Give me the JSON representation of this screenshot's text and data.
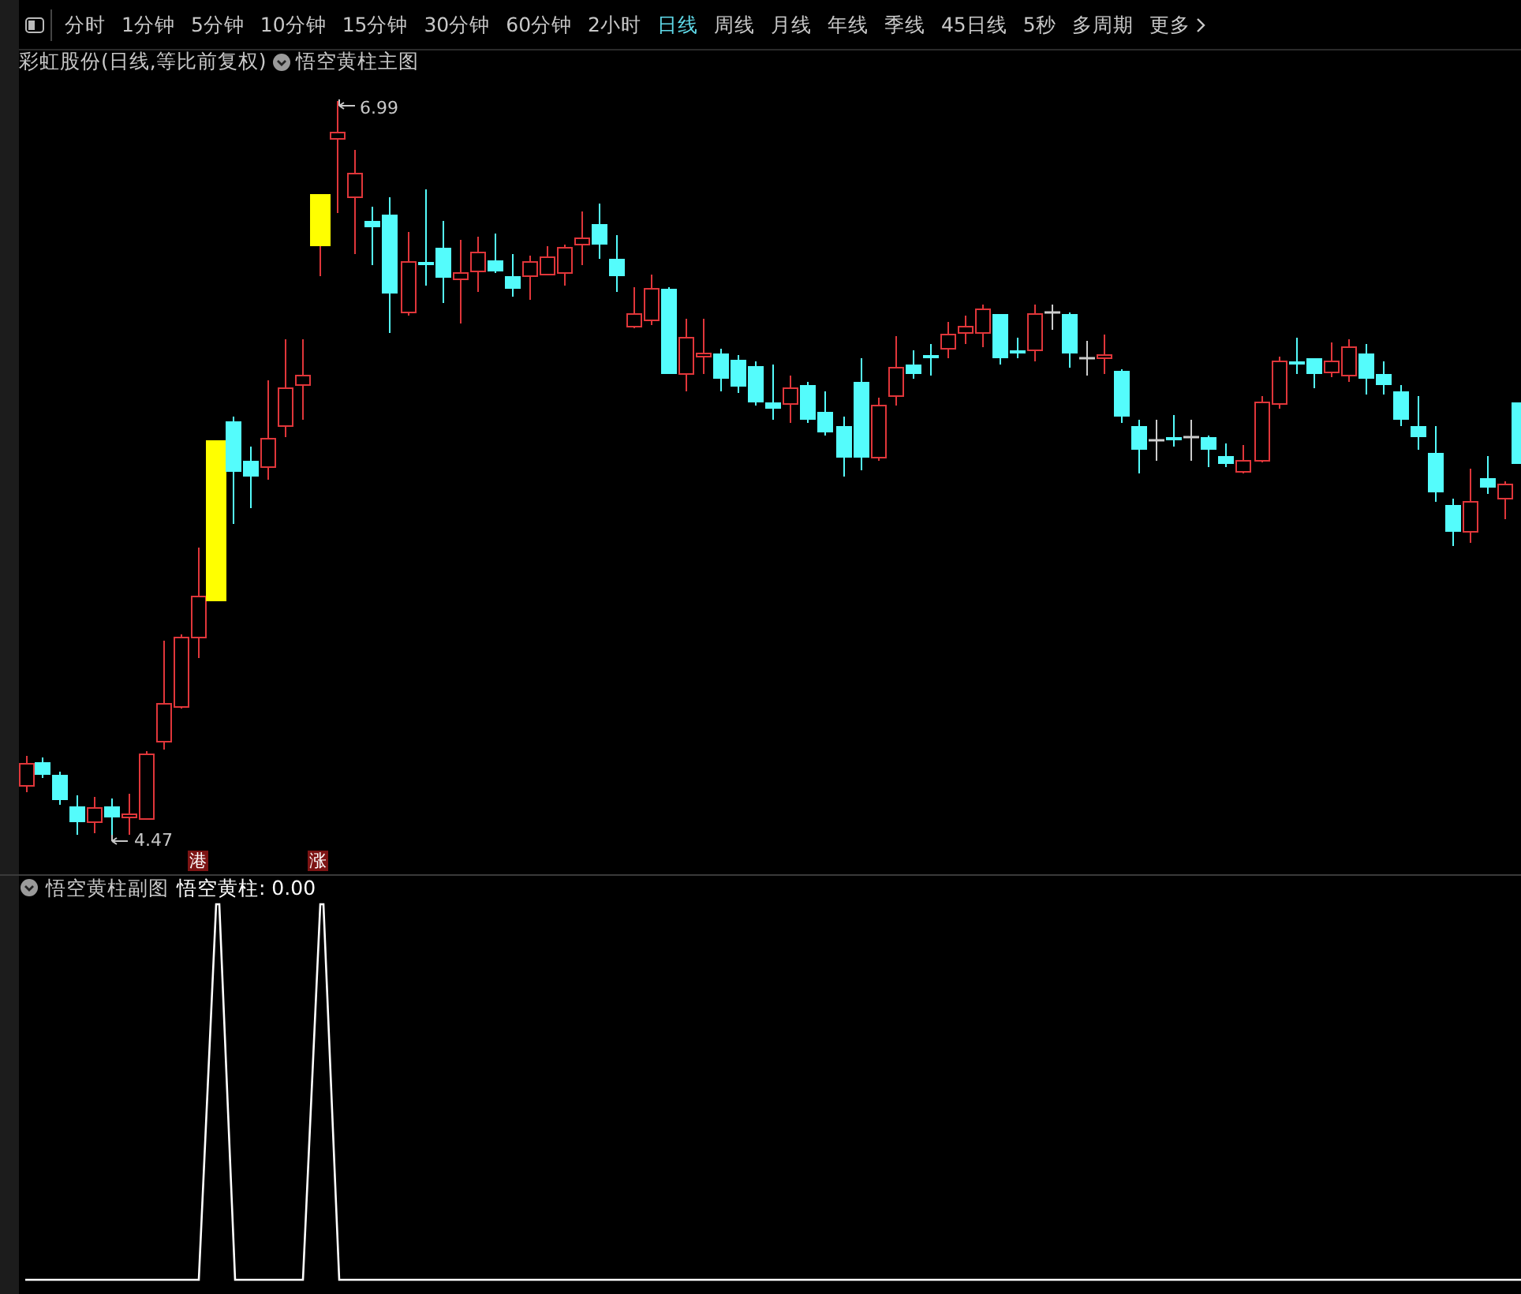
{
  "toolbar": {
    "periods": [
      {
        "label": "分时",
        "selected": false
      },
      {
        "label": "1分钟",
        "selected": false
      },
      {
        "label": "5分钟",
        "selected": false
      },
      {
        "label": "10分钟",
        "selected": false
      },
      {
        "label": "15分钟",
        "selected": false
      },
      {
        "label": "30分钟",
        "selected": false
      },
      {
        "label": "60分钟",
        "selected": false
      },
      {
        "label": "2小时",
        "selected": false
      },
      {
        "label": "日线",
        "selected": true
      },
      {
        "label": "周线",
        "selected": false
      },
      {
        "label": "月线",
        "selected": false
      },
      {
        "label": "年线",
        "selected": false
      },
      {
        "label": "季线",
        "selected": false
      },
      {
        "label": "45日线",
        "selected": false
      },
      {
        "label": "5秒",
        "selected": false
      },
      {
        "label": "多周期",
        "selected": false
      }
    ],
    "more": "更多"
  },
  "main_chart": {
    "title": "彩虹股份(日线,等比前复权)",
    "indicator": "悟空黄柱主图",
    "high_label": "6.99",
    "low_label": "4.47",
    "event_marks": [
      {
        "label": "港"
      },
      {
        "label": "涨"
      }
    ]
  },
  "sub_chart": {
    "title": "悟空黄柱副图",
    "reading": "悟空黄柱: 0.00"
  }
}
